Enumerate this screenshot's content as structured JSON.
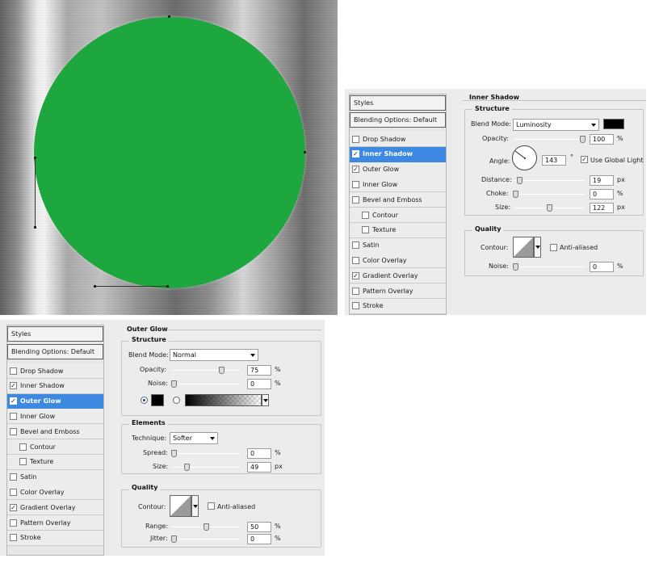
{
  "colors": {
    "circle_fill": "#1ea63f",
    "selected_row": "#3d88e0",
    "swatch_black": "#000000"
  },
  "inner_shadow_dialog": {
    "styles_header": "Styles",
    "blending_options": "Blending Options: Default",
    "list": [
      {
        "label": "Drop Shadow",
        "checked": false
      },
      {
        "label": "Inner Shadow",
        "checked": true,
        "selected": true
      },
      {
        "label": "Outer Glow",
        "checked": true
      },
      {
        "label": "Inner Glow",
        "checked": false
      },
      {
        "label": "Bevel and Emboss",
        "checked": false
      },
      {
        "label": "Contour",
        "checked": false,
        "indent": true
      },
      {
        "label": "Texture",
        "checked": false,
        "indent": true
      },
      {
        "label": "Satin",
        "checked": false
      },
      {
        "label": "Color Overlay",
        "checked": false
      },
      {
        "label": "Gradient Overlay",
        "checked": true
      },
      {
        "label": "Pattern Overlay",
        "checked": false
      },
      {
        "label": "Stroke",
        "checked": false
      }
    ],
    "title": "Inner Shadow",
    "structure_title": "Structure",
    "blend_mode_label": "Blend Mode:",
    "blend_mode_value": "Luminosity",
    "opacity_label": "Opacity:",
    "opacity_value": "100",
    "angle_label": "Angle:",
    "angle_value": "143",
    "degree_symbol": "°",
    "use_global_light_label": "Use Global Light",
    "use_global_light_checked": true,
    "distance_label": "Distance:",
    "distance_value": "19",
    "choke_label": "Choke:",
    "choke_value": "0",
    "size_label": "Size:",
    "size_value": "122",
    "quality_title": "Quality",
    "contour_label": "Contour:",
    "anti_aliased_label": "Anti-aliased",
    "noise_label": "Noise:",
    "noise_value": "0",
    "unit_percent": "%",
    "unit_px": "px",
    "sliders": {
      "opacity": 1.0,
      "distance": 0.06,
      "choke": 0.0,
      "size": 0.5,
      "noise": 0.0
    }
  },
  "outer_glow_dialog": {
    "styles_header": "Styles",
    "blending_options": "Blending Options: Default",
    "list": [
      {
        "label": "Drop Shadow",
        "checked": false
      },
      {
        "label": "Inner Shadow",
        "checked": true
      },
      {
        "label": "Outer Glow",
        "checked": true,
        "selected": true
      },
      {
        "label": "Inner Glow",
        "checked": false
      },
      {
        "label": "Bevel and Emboss",
        "checked": false
      },
      {
        "label": "Contour",
        "checked": false,
        "indent": true
      },
      {
        "label": "Texture",
        "checked": false,
        "indent": true
      },
      {
        "label": "Satin",
        "checked": false
      },
      {
        "label": "Color Overlay",
        "checked": false
      },
      {
        "label": "Gradient Overlay",
        "checked": true
      },
      {
        "label": "Pattern Overlay",
        "checked": false
      },
      {
        "label": "Stroke",
        "checked": false
      }
    ],
    "title": "Outer Glow",
    "structure_title": "Structure",
    "blend_mode_label": "Blend Mode:",
    "blend_mode_value": "Normal",
    "opacity_label": "Opacity:",
    "opacity_value": "75",
    "noise_label": "Noise:",
    "noise_value": "0",
    "elements_title": "Elements",
    "technique_label": "Technique:",
    "technique_value": "Softer",
    "spread_label": "Spread:",
    "spread_value": "0",
    "size_label": "Size:",
    "size_value": "49",
    "quality_title": "Quality",
    "contour_label": "Contour:",
    "anti_aliased_label": "Anti-aliased",
    "range_label": "Range:",
    "range_value": "50",
    "jitter_label": "Jitter:",
    "jitter_value": "0",
    "unit_percent": "%",
    "unit_px": "px",
    "sliders": {
      "opacity": 0.75,
      "noise": 0.0,
      "spread": 0.0,
      "size": 0.2,
      "range": 0.5,
      "jitter": 0.0
    }
  }
}
